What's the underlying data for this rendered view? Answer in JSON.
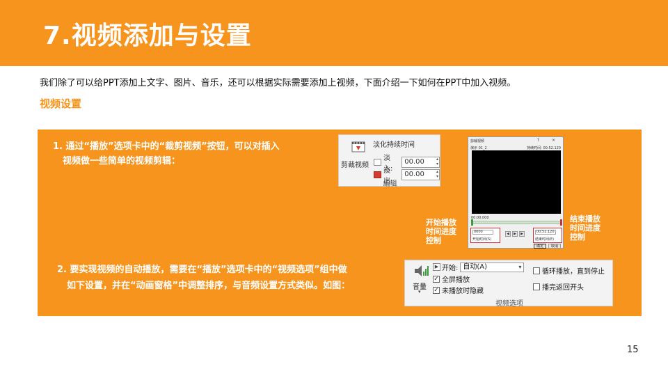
{
  "title": "7.视频添加与设置",
  "intro": "我们除了可以给PPT添加上文字、图片、音乐，还可以根据实际需要添加上视频，下面介绍一下如何在PPT中加入视频。",
  "subheading": "视频设置",
  "step1": {
    "line1": "1. 通过“播放”选项卡中的“裁剪视频”按钮，可以对插入",
    "line2": "视频做一些简单的视频剪辑："
  },
  "step2": {
    "line1": "2. 要实现视频的自动播放，需要在“播放”选项卡中的“视频选项”组中做",
    "line2": "如下设置，并在“动画窗格”中调整排序，与音频设置方式类似。如图："
  },
  "ribbon_edit": {
    "trim_label": "剪裁视频",
    "fade_title": "淡化持续时间",
    "fade_in_label": "淡入:",
    "fade_in_value": "00.00",
    "fade_out_label": "淡出:",
    "fade_out_value": "00.00",
    "group_label": "编辑"
  },
  "trim_dialog": {
    "title": "剪裁视频",
    "controls": "? ×",
    "clip_name": "演示 01_2",
    "duration": "持续时间: 00:52.120",
    "time_readout": "00:00.000",
    "start_value": "0000",
    "start_label": "开始时间(S)",
    "end_value": "00:52.120",
    "end_label": "结束时间(E)",
    "ok_label": "确定",
    "cancel_label": "取消"
  },
  "annotations": {
    "left": [
      "开始播放",
      "时间进度",
      "控制"
    ],
    "right": [
      "结束播放",
      "时间进度",
      "控制"
    ]
  },
  "ribbon_video_options": {
    "volume_label": "音量",
    "start_label": "开始:",
    "start_value": "自动(A)",
    "fullscreen_label": "全屏播放",
    "hide_label": "未播放时隐藏",
    "loop_label": "循环播放，直到停止",
    "rewind_label": "播完返回开头",
    "group_label": "视频选项"
  },
  "page_number": "15",
  "colors": {
    "accent": "#f7941d",
    "marker_red": "#d03030",
    "marker_green": "#3d9a3d"
  }
}
